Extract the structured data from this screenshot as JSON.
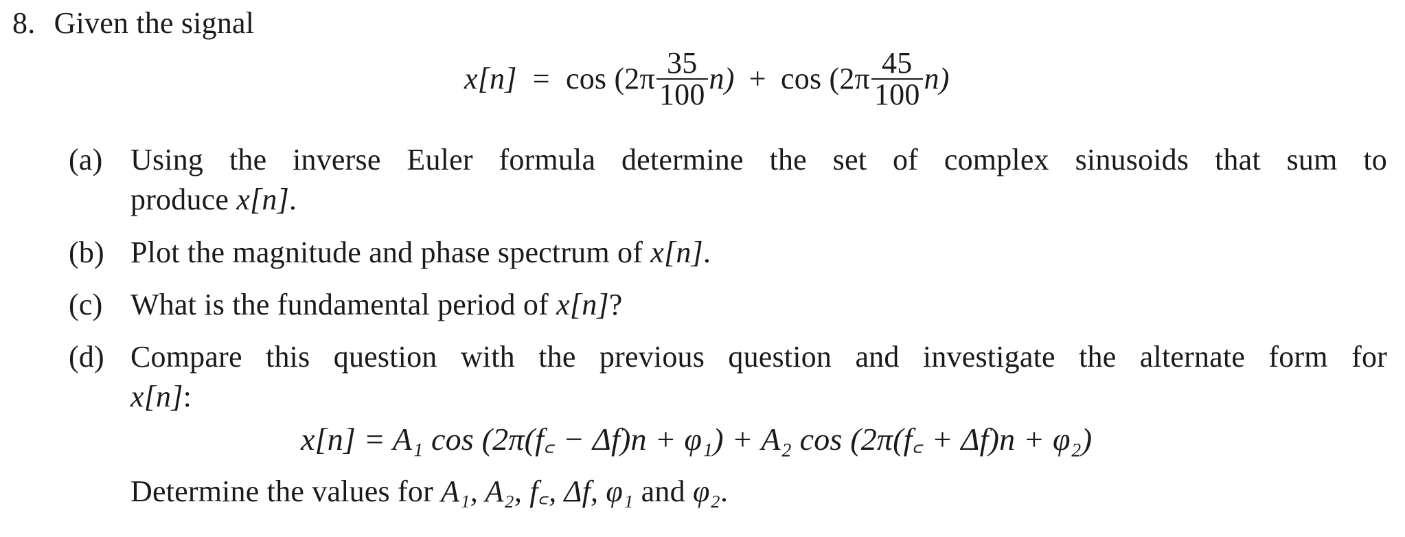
{
  "problem": {
    "number": "8.",
    "intro": "Given the signal",
    "equation1": {
      "lhs": "x[n]",
      "eq": "=",
      "term1_prefix": "cos (2π",
      "term1_num": "35",
      "term1_den": "100",
      "term1_suffix": "n)",
      "plus": "+",
      "term2_prefix": "cos (2π",
      "term2_num": "45",
      "term2_den": "100",
      "term2_suffix": "n)"
    },
    "parts": [
      {
        "label": "(a)",
        "line1": "Using the inverse Euler formula determine the set of complex sinusoids that sum to",
        "line2_text": "produce ",
        "line2_math": "x[n]",
        "line2_end": "."
      },
      {
        "label": "(b)",
        "text": "Plot the magnitude and phase spectrum of ",
        "math": "x[n]",
        "end": "."
      },
      {
        "label": "(c)",
        "text": "What is the fundamental period of ",
        "math": "x[n]",
        "end": "?"
      },
      {
        "label": "(d)",
        "line1": "Compare this question with the previous question and investigate the alternate form for",
        "line2_math": "x[n]",
        "line2_end": ":",
        "equation2": "x[n] = A₁ cos (2π(f꜀ − Δf)n + φ₁) + A₂ cos (2π(f꜀ + Δf)n + φ₂)",
        "determine_text": "Determine the values for ",
        "determine_math": "A₁, A₂, f꜀, Δf, φ₁",
        "determine_and": " and ",
        "determine_last": "φ₂",
        "determine_end": "."
      }
    ]
  }
}
